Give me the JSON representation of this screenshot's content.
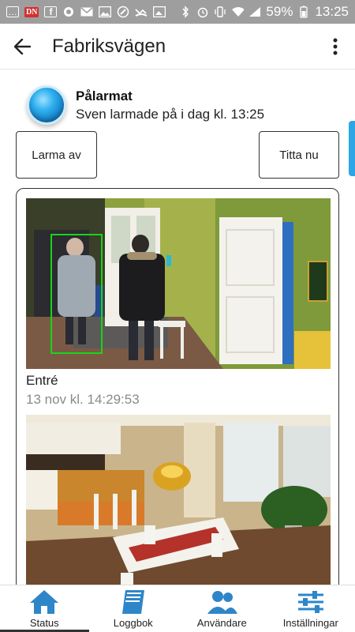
{
  "statusbar": {
    "left_icons": [
      "chat-icon",
      "dn-news-icon",
      "facebook-icon",
      "circle-icon",
      "email-icon",
      "image-icon",
      "settings-icon",
      "missed-call-icon",
      "gallery-icon"
    ],
    "dn_label": "DN",
    "right_icons": [
      "bluetooth-icon",
      "alarm-clock-icon",
      "vibrate-icon",
      "wifi-icon",
      "signal-icon",
      "battery-icon"
    ],
    "battery": "59%",
    "time": "13:25"
  },
  "appbar": {
    "title": "Fabriksvägen"
  },
  "alarm": {
    "title": "Pålarmat",
    "subtitle": "Sven larmade på i dag kl. 13:25"
  },
  "actions": {
    "disarm_label": "Larma av",
    "watch_label": "Titta nu"
  },
  "cameras": [
    {
      "name": "Entré",
      "timestamp": "13 nov kl. 14:29:53"
    },
    {
      "name": "",
      "timestamp": ""
    }
  ],
  "nav": [
    {
      "label": "Status",
      "icon": "home-icon",
      "active": true
    },
    {
      "label": "Loggbok",
      "icon": "book-icon",
      "active": false
    },
    {
      "label": "Användare",
      "icon": "users-icon",
      "active": false
    },
    {
      "label": "Inställningar",
      "icon": "sliders-icon",
      "active": false
    }
  ],
  "colors": {
    "accent": "#2e86c9",
    "statusbar": "#9e9e9e",
    "detection_box": "#19d419"
  }
}
